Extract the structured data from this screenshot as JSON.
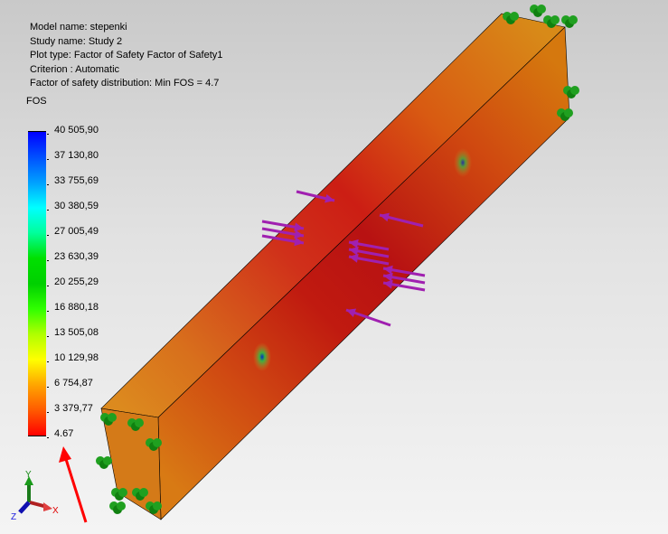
{
  "info": {
    "model_name": "Model name: stepenki",
    "study_name": "Study name: Study 2",
    "plot_type": "Plot type: Factor of Safety Factor of Safety1",
    "criterion": "Criterion : Automatic",
    "distribution": "Factor of safety distribution: Min FOS = 4.7"
  },
  "legend": {
    "title": "FOS",
    "ticks": [
      "40 505,90",
      "37 130,80",
      "33 755,69",
      "30 380,59",
      "27 005,49",
      "23 630,39",
      "20 255,29",
      "16 880,18",
      "13 505,08",
      "10 129,98",
      "6 754,87",
      "3 379,77",
      "4.67"
    ],
    "colors": [
      "#0000ff",
      "#0050ff",
      "#00a0ff",
      "#00ffff",
      "#00ff9a",
      "#00e000",
      "#00d000",
      "#30ff00",
      "#b0ff00",
      "#ffff00",
      "#ffa500",
      "#ff5a00",
      "#ff0000"
    ]
  },
  "triad": {
    "x": "X",
    "y": "Y",
    "z": "Z"
  },
  "colors": {
    "beam_min": "#c81010",
    "beam_mid": "#d86a10",
    "load_arrow": "#a020b0",
    "fixture": "#20a020",
    "annotation_arrow": "#ff0000"
  }
}
